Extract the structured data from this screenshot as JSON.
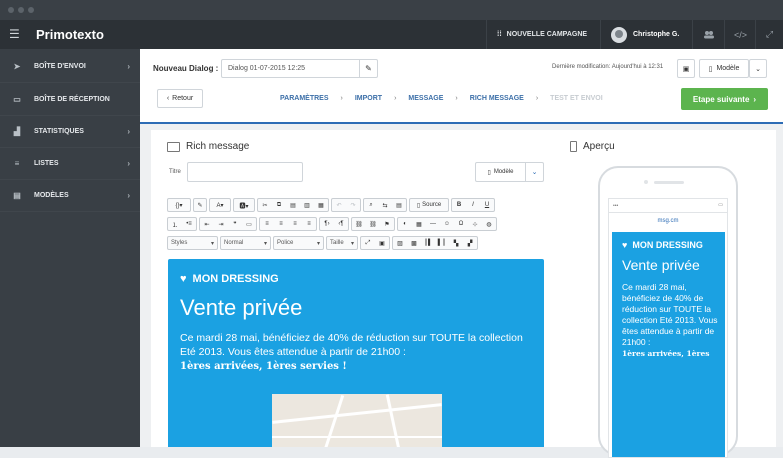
{
  "app": {
    "brand": "Primotexto",
    "menu_icon": "hamburger-icon"
  },
  "topbar": {
    "new_campaign": "NOUVELLE CAMPAGNE",
    "user_name": "Christophe G.",
    "icons": [
      "users-icon",
      "code-icon",
      "fullscreen-icon"
    ]
  },
  "sidebar": {
    "items": [
      {
        "label": "BOÎTE D'ENVOI",
        "icon": "send-icon",
        "chevron": "›"
      },
      {
        "label": "BOÎTE DE RÉCEPTION",
        "icon": "inbox-icon",
        "chevron": ""
      },
      {
        "label": "STATISTIQUES",
        "icon": "stats-icon",
        "chevron": "›"
      },
      {
        "label": "LISTES",
        "icon": "list-icon",
        "chevron": "›"
      },
      {
        "label": "MODÈLES",
        "icon": "template-icon",
        "chevron": "›"
      }
    ]
  },
  "header": {
    "dialog_label": "Nouveau Dialog :",
    "dialog_value": "Dialog 01-07-2015 12:25",
    "last_modified": "Dernière modification: Aujourd'hui à 12:31",
    "modele_label": "Modèle",
    "retour": "Retour",
    "steps": [
      "PARAMÈTRES",
      "IMPORT",
      "MESSAGE",
      "RICH MESSAGE",
      "TEST ET ENVOI"
    ],
    "next_step": "Etape suivante"
  },
  "editor": {
    "title": "Rich message",
    "titre_label": "Titre",
    "titre_value": "",
    "modele_label": "Modèle",
    "source_label": "Source",
    "selects": [
      "Styles",
      "Normal",
      "Police",
      "Taille"
    ]
  },
  "mail": {
    "brand": "MON DRESSING",
    "headline": "Vente privée",
    "body": "Ce mardi 28 mai, bénéficiez de 40% de réduction sur TOUTE la collection Eté 2013. Vous êtes attendue à partir de 21h00 :",
    "bold_line": "1ères arrivées, 1ères servies !"
  },
  "preview": {
    "title": "Aperçu",
    "url": "msg.cm",
    "brand": "MON DRESSING",
    "headline": "Vente privée",
    "body": "Ce mardi 28 mai, bénéficiez de 40% de réduction sur TOUTE la collection Eté 2013. Vous êtes attendue à partir de 21h00 :",
    "bold_line": "1ères arrivées, 1ères"
  },
  "colors": {
    "accent": "#2d6cb5",
    "mail_bg": "#1ba1e2",
    "next_btn": "#5cb44e",
    "sidebar": "#393f45"
  }
}
